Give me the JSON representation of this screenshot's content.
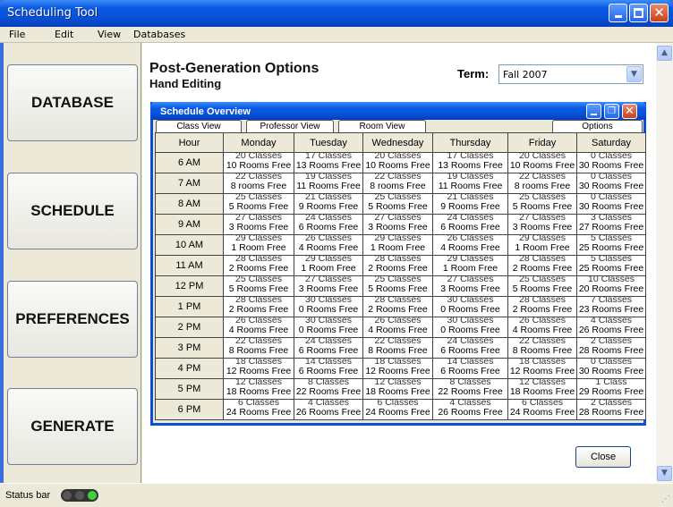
{
  "window": {
    "title": "Scheduling Tool"
  },
  "menu": [
    "File",
    "Edit",
    "View",
    "Databases"
  ],
  "nav": [
    "DATABASE",
    "SCHEDULE",
    "PREFERENCES",
    "GENERATE"
  ],
  "main": {
    "heading": "Post-Generation Options",
    "subheading": "Hand Editing",
    "term_label": "Term:",
    "term_value": "Fall 2007",
    "close_label": "Close"
  },
  "overview": {
    "title": "Schedule Overview",
    "tabs": [
      "Class View",
      "Professor View",
      "Room View"
    ],
    "options_label": "Options",
    "columns": [
      "Hour",
      "Monday",
      "Tuesday",
      "Wednesday",
      "Thursday",
      "Friday",
      "Saturday"
    ],
    "rows": [
      {
        "hour": "6 AM",
        "cells": [
          [
            "20 Classes",
            "10 Rooms Free"
          ],
          [
            "17 Classes",
            "13 Rooms Free"
          ],
          [
            "20 Classes",
            "10 Rooms Free"
          ],
          [
            "17 Classes",
            "13 Rooms Free"
          ],
          [
            "20 Classes",
            "10 Rooms Free"
          ],
          [
            "0 Classes",
            "30 Rooms Free"
          ]
        ]
      },
      {
        "hour": "7 AM",
        "cells": [
          [
            "22 Classes",
            "8 rooms Free"
          ],
          [
            "19 Classes",
            "11 Rooms Free"
          ],
          [
            "22 Classes",
            "8 rooms Free"
          ],
          [
            "19 Classes",
            "11 Rooms Free"
          ],
          [
            "22 Classes",
            "8 rooms Free"
          ],
          [
            "0 Classes",
            "30 Rooms Free"
          ]
        ]
      },
      {
        "hour": "8 AM",
        "cells": [
          [
            "25 Classes",
            "5 Rooms Free"
          ],
          [
            "21 Classes",
            "9 Rooms Free"
          ],
          [
            "25 Classes",
            "5 Rooms Free"
          ],
          [
            "21 Classes",
            "9 Rooms Free"
          ],
          [
            "25 Classes",
            "5 Rooms Free"
          ],
          [
            "0 Classes",
            "30 Rooms Free"
          ]
        ]
      },
      {
        "hour": "9 AM",
        "cells": [
          [
            "27 Classes",
            "3 Rooms Free"
          ],
          [
            "24 Classes",
            "6 Rooms Free"
          ],
          [
            "27 Classes",
            "3 Rooms Free"
          ],
          [
            "24 Classes",
            "6 Rooms Free"
          ],
          [
            "27 Classes",
            "3 Rooms Free"
          ],
          [
            "3 Classes",
            "27 Rooms Free"
          ]
        ]
      },
      {
        "hour": "10 AM",
        "cells": [
          [
            "29 Classes",
            "1 Room Free"
          ],
          [
            "26 Classes",
            "4 Rooms Free"
          ],
          [
            "29 Classes",
            "1 Room Free"
          ],
          [
            "26 Classes",
            "4 Rooms Free"
          ],
          [
            "29 Classes",
            "1 Room Free"
          ],
          [
            "5 Classes",
            "25 Rooms Free"
          ]
        ]
      },
      {
        "hour": "11 AM",
        "cells": [
          [
            "28 Classes",
            "2 Rooms Free"
          ],
          [
            "29 Classes",
            "1 Room Free"
          ],
          [
            "28 Classes",
            "2 Rooms Free"
          ],
          [
            "29 Classes",
            "1 Room Free"
          ],
          [
            "28 Classes",
            "2 Rooms Free"
          ],
          [
            "5 Classes",
            "25 Rooms Free"
          ]
        ]
      },
      {
        "hour": "12 PM",
        "cells": [
          [
            "25 Classes",
            "5 Rooms Free"
          ],
          [
            "27 Classes",
            "3 Rooms Free"
          ],
          [
            "25 Classes",
            "5 Rooms Free"
          ],
          [
            "27 Classes",
            "3 Rooms Free"
          ],
          [
            "25 Classes",
            "5 Rooms Free"
          ],
          [
            "10 Classes",
            "20 Rooms Free"
          ]
        ]
      },
      {
        "hour": "1 PM",
        "cells": [
          [
            "28 Classes",
            "2 Rooms Free"
          ],
          [
            "30 Classes",
            "0 Rooms Free"
          ],
          [
            "28 Classes",
            "2 Rooms Free"
          ],
          [
            "30 Classes",
            "0 Rooms Free"
          ],
          [
            "28 Classes",
            "2 Rooms Free"
          ],
          [
            "7 Classes",
            "23 Rooms Free"
          ]
        ]
      },
      {
        "hour": "2 PM",
        "cells": [
          [
            "26 Classes",
            "4 Rooms Free"
          ],
          [
            "30 Classes",
            "0 Rooms Free"
          ],
          [
            "26 Classes",
            "4 Rooms Free"
          ],
          [
            "30 Classes",
            "0 Rooms Free"
          ],
          [
            "26 Classes",
            "4 Rooms Free"
          ],
          [
            "4 Classes",
            "26 Rooms Free"
          ]
        ]
      },
      {
        "hour": "3 PM",
        "cells": [
          [
            "22 Classes",
            "8 Rooms Free"
          ],
          [
            "24 Classes",
            "6 Rooms Free"
          ],
          [
            "22 Classes",
            "8 Rooms Free"
          ],
          [
            "24 Classes",
            "6 Rooms Free"
          ],
          [
            "22 Classes",
            "8 Rooms Free"
          ],
          [
            "2 Classes",
            "28 Rooms Free"
          ]
        ]
      },
      {
        "hour": "4 PM",
        "cells": [
          [
            "18 Classes",
            "12 Rooms Free"
          ],
          [
            "14 Classes",
            "6 Rooms Free"
          ],
          [
            "18 Classes",
            "12 Rooms Free"
          ],
          [
            "14 Classes",
            "6 Rooms Free"
          ],
          [
            "18 Classes",
            "12 Rooms Free"
          ],
          [
            "0 Classes",
            "30 Rooms Free"
          ]
        ]
      },
      {
        "hour": "5 PM",
        "cells": [
          [
            "12 Classes",
            "18 Rooms Free"
          ],
          [
            "8 Classes",
            "22 Rooms Free"
          ],
          [
            "12 Classes",
            "18 Rooms Free"
          ],
          [
            "8 Classes",
            "22 Rooms Free"
          ],
          [
            "12 Classes",
            "18 Rooms Free"
          ],
          [
            "1 Class",
            "29 Rooms Free"
          ]
        ]
      },
      {
        "hour": "6 PM",
        "cells": [
          [
            "6 Classes",
            "24 Rooms Free"
          ],
          [
            "4 Classes",
            "26 Rooms Free"
          ],
          [
            "6 Classes",
            "24 Rooms Free"
          ],
          [
            "4 Classes",
            "26 Rooms Free"
          ],
          [
            "6 Classes",
            "24 Rooms Free"
          ],
          [
            "2 Classes",
            "28 Rooms Free"
          ]
        ]
      }
    ]
  },
  "status": {
    "text": "Status bar"
  }
}
